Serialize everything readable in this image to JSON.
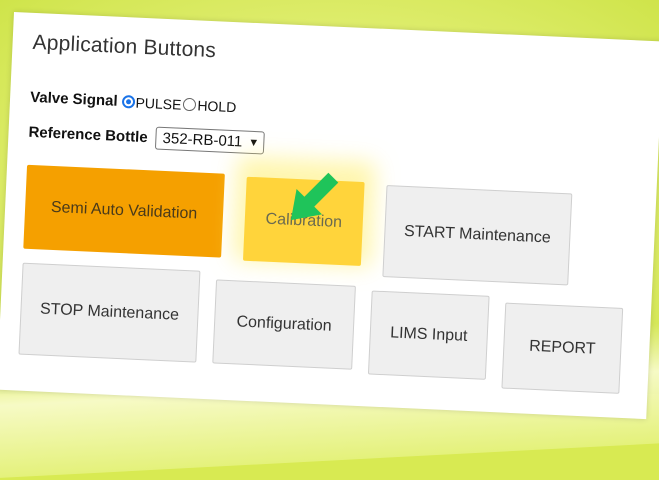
{
  "panel": {
    "title": "Application Buttons"
  },
  "valve_signal": {
    "label": "Valve Signal",
    "options": [
      {
        "label": "PULSE",
        "selected": true
      },
      {
        "label": "HOLD",
        "selected": false
      }
    ]
  },
  "reference_bottle": {
    "label": "Reference Bottle",
    "selected_value": "352-RB-011"
  },
  "buttons": {
    "semi_auto": "Semi Auto Validation",
    "calibration": "Calibration",
    "start_maintenance": "START Maintenance",
    "stop_maintenance": "STOP Maintenance",
    "configuration": "Configuration",
    "lims_input": "LIMS Input",
    "report": "REPORT"
  },
  "colors": {
    "accent_orange": "#f5a000",
    "accent_yellow": "#ffd43b",
    "arrow_green": "#1fc45a",
    "radio_blue": "#1a73e8"
  },
  "icons": {
    "pointer": "green-arrow-icon"
  }
}
